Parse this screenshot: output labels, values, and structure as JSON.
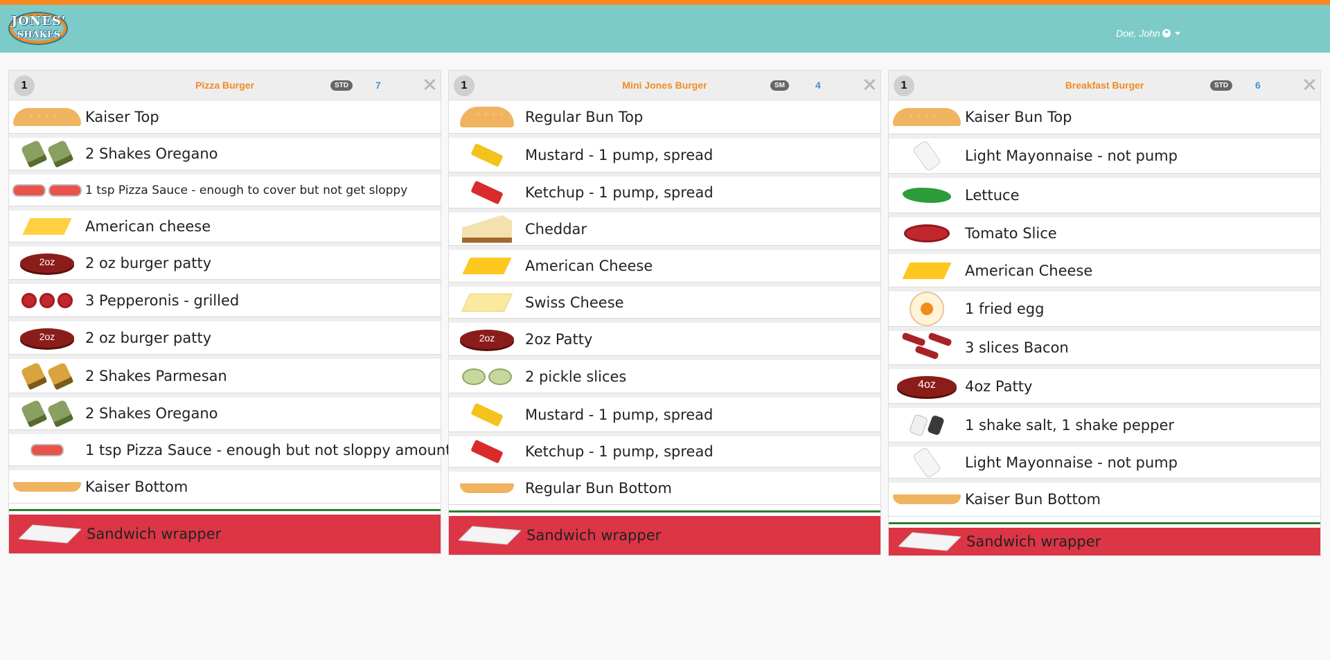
{
  "header": {
    "logo_line1": "JONES'",
    "logo_line2": "SHAKES",
    "user": "Doe, John"
  },
  "colors": {
    "top_stripe": "#f7871f",
    "navbar": "#7ccbc8",
    "title": "#f28a22",
    "count": "#4a8ed0",
    "wrapper": "#dc3545",
    "divider": "#2e7d32"
  },
  "cards": [
    {
      "qty": "1",
      "title": "Pizza Burger",
      "size": "STD",
      "count": "7",
      "items": [
        {
          "text": "Kaiser Top",
          "icon": "kaiser-top-icon"
        },
        {
          "text": "2 Shakes Oregano",
          "icon": "oregano-shaker-icon"
        },
        {
          "text": "1 tsp Pizza Sauce - enough to cover but not get sloppy",
          "icon": "pizza-sauce-icon"
        },
        {
          "text": "American cheese",
          "icon": "american-cheese-icon"
        },
        {
          "text": "2 oz burger patty",
          "icon": "patty-2oz-icon"
        },
        {
          "text": "3 Pepperonis - grilled",
          "icon": "pepperoni-icon"
        },
        {
          "text": "2 oz burger patty",
          "icon": "patty-2oz-icon"
        },
        {
          "text": "2 Shakes Parmesan",
          "icon": "parmesan-shaker-icon"
        },
        {
          "text": "2 Shakes Oregano",
          "icon": "oregano-shaker-icon"
        },
        {
          "text": "1 tsp Pizza Sauce - enough but not sloppy amount",
          "icon": "pizza-sauce-icon"
        },
        {
          "text": "Kaiser Bottom",
          "icon": "kaiser-bottom-icon"
        }
      ],
      "wrapper": "Sandwich wrapper"
    },
    {
      "qty": "1",
      "title": "Mini Jones Burger",
      "size": "SM",
      "count": "4",
      "items": [
        {
          "text": "Regular Bun Top",
          "icon": "bun-top-icon"
        },
        {
          "text": "Mustard - 1 pump, spread",
          "icon": "mustard-icon"
        },
        {
          "text": "Ketchup - 1 pump, spread",
          "icon": "ketchup-icon"
        },
        {
          "text": "Cheddar",
          "icon": "cheddar-icon"
        },
        {
          "text": "American Cheese",
          "icon": "american-cheese-icon"
        },
        {
          "text": "Swiss Cheese",
          "icon": "swiss-cheese-icon"
        },
        {
          "text": "2oz Patty",
          "icon": "patty-2oz-icon"
        },
        {
          "text": "2 pickle slices",
          "icon": "pickle-icon"
        },
        {
          "text": "Mustard - 1 pump, spread",
          "icon": "mustard-icon"
        },
        {
          "text": "Ketchup - 1 pump, spread",
          "icon": "ketchup-icon"
        },
        {
          "text": "Regular Bun Bottom",
          "icon": "bun-bottom-icon"
        }
      ],
      "wrapper": "Sandwich wrapper"
    },
    {
      "qty": "1",
      "title": "Breakfast Burger",
      "size": "STD",
      "count": "6",
      "items": [
        {
          "text": "Kaiser Bun Top",
          "icon": "kaiser-top-icon"
        },
        {
          "text": "Light Mayonnaise - not pump",
          "icon": "mayo-icon"
        },
        {
          "text": "Lettuce",
          "icon": "lettuce-icon"
        },
        {
          "text": "Tomato Slice",
          "icon": "tomato-icon"
        },
        {
          "text": "American Cheese",
          "icon": "american-cheese-icon"
        },
        {
          "text": "1 fried egg",
          "icon": "egg-icon"
        },
        {
          "text": "3 slices Bacon",
          "icon": "bacon-icon"
        },
        {
          "text": "4oz Patty",
          "icon": "patty-4oz-icon"
        },
        {
          "text": "1 shake salt, 1 shake pepper",
          "icon": "salt-pepper-icon"
        },
        {
          "text": "Light Mayonnaise - not pump",
          "icon": "mayo-icon"
        },
        {
          "text": "Kaiser Bun Bottom",
          "icon": "kaiser-bottom-icon"
        }
      ],
      "wrapper": "Sandwich wrapper"
    }
  ],
  "patty_labels": {
    "two": "2oz",
    "four": "4oz"
  }
}
